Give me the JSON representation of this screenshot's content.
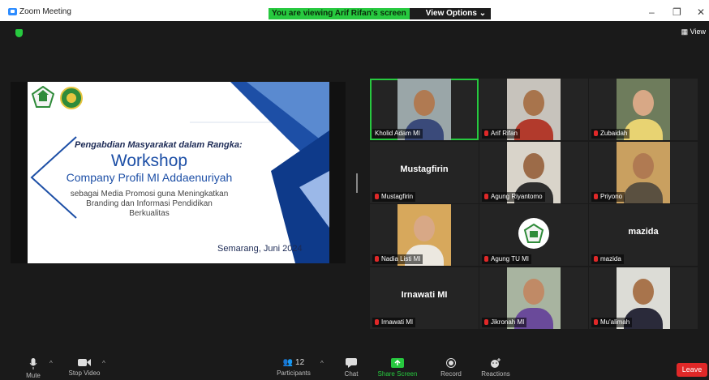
{
  "window": {
    "title": "Zoom Meeting"
  },
  "share_banner": {
    "message": "You are viewing Arif Rifan's screen",
    "options_label": "View Options"
  },
  "window_controls": {
    "minimize": "–",
    "restore": "❐",
    "close": "✕"
  },
  "view_button": {
    "label": "View"
  },
  "slide": {
    "line1": "Pengabdian Masyarakat dalam Rangka:",
    "title": "Workshop",
    "subtitle": "Company Profil MI Addaenuriyah",
    "body1": "sebagai Media Promosi guna Meningkatkan",
    "body2": "Branding dan Informasi Pendidikan",
    "body3": "Berkualitas",
    "date": "Semarang,  Juni 2024"
  },
  "participants": [
    {
      "name": "Kholid Adam MI",
      "video": true,
      "muted": false,
      "active": true,
      "bg": "#3a3a3a",
      "skin": "#b07a52",
      "shirt": "#3a4a7a",
      "wall": "#9aa6a8"
    },
    {
      "name": "Arif Rifan",
      "video": true,
      "muted": true,
      "active": false,
      "bg": "#4a4440",
      "skin": "#a8744c",
      "shirt": "#b23a2c",
      "wall": "#c7c3bc"
    },
    {
      "name": "Zubaidah",
      "video": true,
      "muted": true,
      "active": false,
      "bg": "#2c2c2c",
      "skin": "#d8a886",
      "shirt": "#e8d372",
      "wall": "#6e7c5c"
    },
    {
      "name": "Mustagfirin",
      "video": false,
      "muted": true,
      "display": "Mustagfirin"
    },
    {
      "name": "Agung Riyantomo",
      "video": true,
      "muted": true,
      "active": false,
      "bg": "#2a2a2a",
      "skin": "#9c6b48",
      "shirt": "#2e2e2e",
      "wall": "#d9d4ca"
    },
    {
      "name": "Priyono",
      "video": true,
      "muted": true,
      "active": false,
      "bg": "#3a3020",
      "skin": "#b07a52",
      "shirt": "#5a5040",
      "wall": "#c9a060"
    },
    {
      "name": "Nadia Listi MI",
      "video": true,
      "muted": true,
      "active": false,
      "bg": "#2c2c2c",
      "skin": "#d8a886",
      "shirt": "#ece8e0",
      "wall": "#d7a85c"
    },
    {
      "name": "Agung TU MI",
      "video": false,
      "muted": true,
      "logo": true
    },
    {
      "name": "mazida",
      "video": false,
      "muted": true,
      "display": "mazida"
    },
    {
      "name": "Irnawati MI",
      "video": false,
      "muted": true,
      "display": "Irnawati MI"
    },
    {
      "name": "Jikronah MI",
      "video": true,
      "muted": true,
      "active": false,
      "bg": "#2a2a2a",
      "skin": "#c08a66",
      "shirt": "#6a4a9a",
      "wall": "#a8b4a0"
    },
    {
      "name": "Mu'alimah",
      "video": true,
      "muted": true,
      "active": false,
      "bg": "#2a2a2a",
      "skin": "#a8744c",
      "shirt": "#2a2a3a",
      "wall": "#dcdcd6"
    }
  ],
  "toolbar": {
    "mute": "Mute",
    "stop_video": "Stop Video",
    "participants": "Participants",
    "participants_count": "12",
    "chat": "Chat",
    "share_screen": "Share Screen",
    "record": "Record",
    "reactions": "Reactions",
    "leave": "Leave"
  },
  "colors": {
    "accent_green": "#27c93f",
    "leave_red": "#e02828",
    "brand_blue": "#2d8cff",
    "slide_blue": "#1d4fa6"
  },
  "icons": [
    "zoom-logo-icon",
    "shield-icon",
    "grid-view-icon",
    "microphone-icon",
    "camera-icon",
    "participants-icon",
    "chat-icon",
    "share-screen-icon",
    "record-icon",
    "reactions-icon",
    "muted-mic-icon"
  ]
}
